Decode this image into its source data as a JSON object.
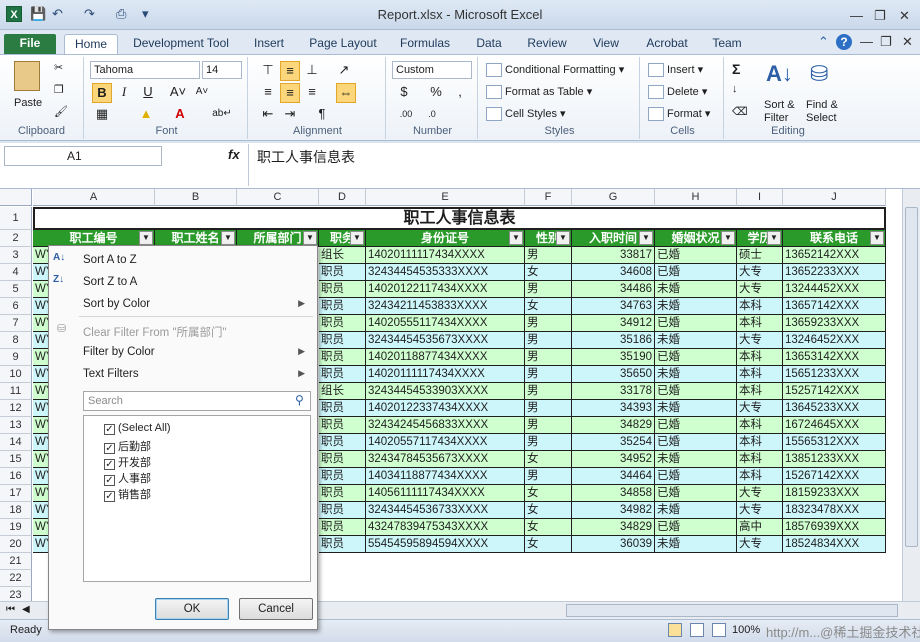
{
  "window": {
    "title": "Report.xlsx - Microsoft Excel",
    "app_icon": "X"
  },
  "tabs": [
    "File",
    "Home",
    "Development Tool",
    "Insert",
    "Page Layout",
    "Formulas",
    "Data",
    "Review",
    "View",
    "Acrobat",
    "Team"
  ],
  "ribbon": {
    "clipboard": {
      "paste": "Paste",
      "label": "Clipboard"
    },
    "font": {
      "name": "Tahoma",
      "size": "14",
      "label": "Font",
      "bold": "B",
      "italic": "I",
      "underline": "U"
    },
    "alignment": {
      "label": "Alignment"
    },
    "number": {
      "format": "Custom",
      "label": "Number"
    },
    "styles": {
      "conditional": "Conditional Formatting",
      "table": "Format as Table",
      "cell": "Cell Styles",
      "label": "Styles"
    },
    "cells": {
      "insert": "Insert",
      "delete": "Delete",
      "format": "Format",
      "label": "Cells"
    },
    "editing": {
      "sort": "Sort &\nFilter",
      "sort1": "Sort &",
      "sort2": "Filter",
      "find1": "Find &",
      "find2": "Select",
      "label": "Editing",
      "sigma": "Σ"
    }
  },
  "formula_bar": {
    "name_box": "A1",
    "fx": "fx",
    "content": "职工人事信息表"
  },
  "sheet": {
    "columns": [
      "A",
      "B",
      "C",
      "D",
      "E",
      "F",
      "G",
      "H",
      "I",
      "J"
    ],
    "title": "职工人事信息表",
    "headers": [
      "职工编号",
      "职工姓名",
      "所属部门",
      "职务",
      "身份证号",
      "性别",
      "入职时间",
      "婚姻状况",
      "学历",
      "联系电话"
    ],
    "rows_visible": [
      [
        "WY",
        "组长",
        "14020111117434XXXX",
        "男",
        "33817",
        "已婚",
        "硕士",
        "13652142XXX"
      ],
      [
        "WY",
        "职员",
        "32434454535333XXXX",
        "女",
        "34608",
        "已婚",
        "大专",
        "13652233XXX"
      ],
      [
        "WY",
        "职员",
        "14020122117434XXXX",
        "男",
        "34486",
        "未婚",
        "大专",
        "13244452XXX"
      ],
      [
        "WY",
        "职员",
        "32434211453833XXXX",
        "女",
        "34763",
        "未婚",
        "本科",
        "13657142XXX"
      ],
      [
        "WY",
        "职员",
        "14020555117434XXXX",
        "男",
        "34912",
        "已婚",
        "本科",
        "13659233XXX"
      ],
      [
        "WY",
        "职员",
        "32434454535673XXXX",
        "男",
        "35186",
        "未婚",
        "大专",
        "13246452XXX"
      ],
      [
        "WY",
        "职员",
        "14020118877434XXXX",
        "男",
        "35190",
        "已婚",
        "本科",
        "13653142XXX"
      ],
      [
        "WY",
        "职员",
        "14020111117434XXXX",
        "男",
        "35650",
        "未婚",
        "本科",
        "15651233XXX"
      ],
      [
        "WY",
        "组长",
        "32434454533903XXXX",
        "男",
        "33178",
        "已婚",
        "本科",
        "15257142XXX"
      ],
      [
        "WY",
        "职员",
        "14020122337434XXXX",
        "男",
        "34393",
        "未婚",
        "大专",
        "13645233XXX"
      ],
      [
        "WY",
        "职员",
        "32434245456833XXXX",
        "男",
        "34829",
        "已婚",
        "本科",
        "16724645XXX"
      ],
      [
        "WY",
        "职员",
        "14020557117434XXXX",
        "男",
        "35254",
        "已婚",
        "本科",
        "15565312XXX"
      ],
      [
        "WY",
        "职员",
        "32434784535673XXXX",
        "女",
        "34952",
        "未婚",
        "本科",
        "13851233XXX"
      ],
      [
        "WY",
        "职员",
        "14034118877434XXXX",
        "男",
        "34464",
        "已婚",
        "本科",
        "15267142XXX"
      ],
      [
        "WY",
        "职员",
        "14056111117434XXXX",
        "女",
        "34858",
        "已婚",
        "大专",
        "18159233XXX"
      ],
      [
        "WY",
        "职员",
        "32434454536733XXXX",
        "女",
        "34982",
        "未婚",
        "大专",
        "18323478XXX"
      ],
      [
        "WY",
        "职员",
        "43247839475343XXXX",
        "女",
        "34829",
        "已婚",
        "高中",
        "18576939XXX"
      ],
      [
        "WY",
        "职员",
        "55454595894594XXXX",
        "女",
        "36039",
        "未婚",
        "大专",
        "18524834XXX"
      ]
    ],
    "row_numbers": [
      "1",
      "2",
      "3",
      "4",
      "5",
      "6",
      "7",
      "8",
      "9",
      "10",
      "11",
      "12",
      "13",
      "14",
      "15",
      "16",
      "17",
      "18",
      "19",
      "20",
      "21",
      "22",
      "23"
    ]
  },
  "filter_menu": {
    "sort_az": "Sort A to Z",
    "sort_za": "Sort Z to A",
    "sort_color": "Sort by Color",
    "clear_filter": "Clear Filter From \"所属部门\"",
    "filter_color": "Filter by Color",
    "text_filters": "Text Filters",
    "search_placeholder": "Search",
    "items": [
      "(Select All)",
      "后勤部",
      "开发部",
      "人事部",
      "销售部"
    ],
    "ok": "OK",
    "cancel": "Cancel"
  },
  "status": {
    "ready": "Ready",
    "zoom": "100%",
    "watermark": "http://m...@稀土掘金技术社区"
  }
}
